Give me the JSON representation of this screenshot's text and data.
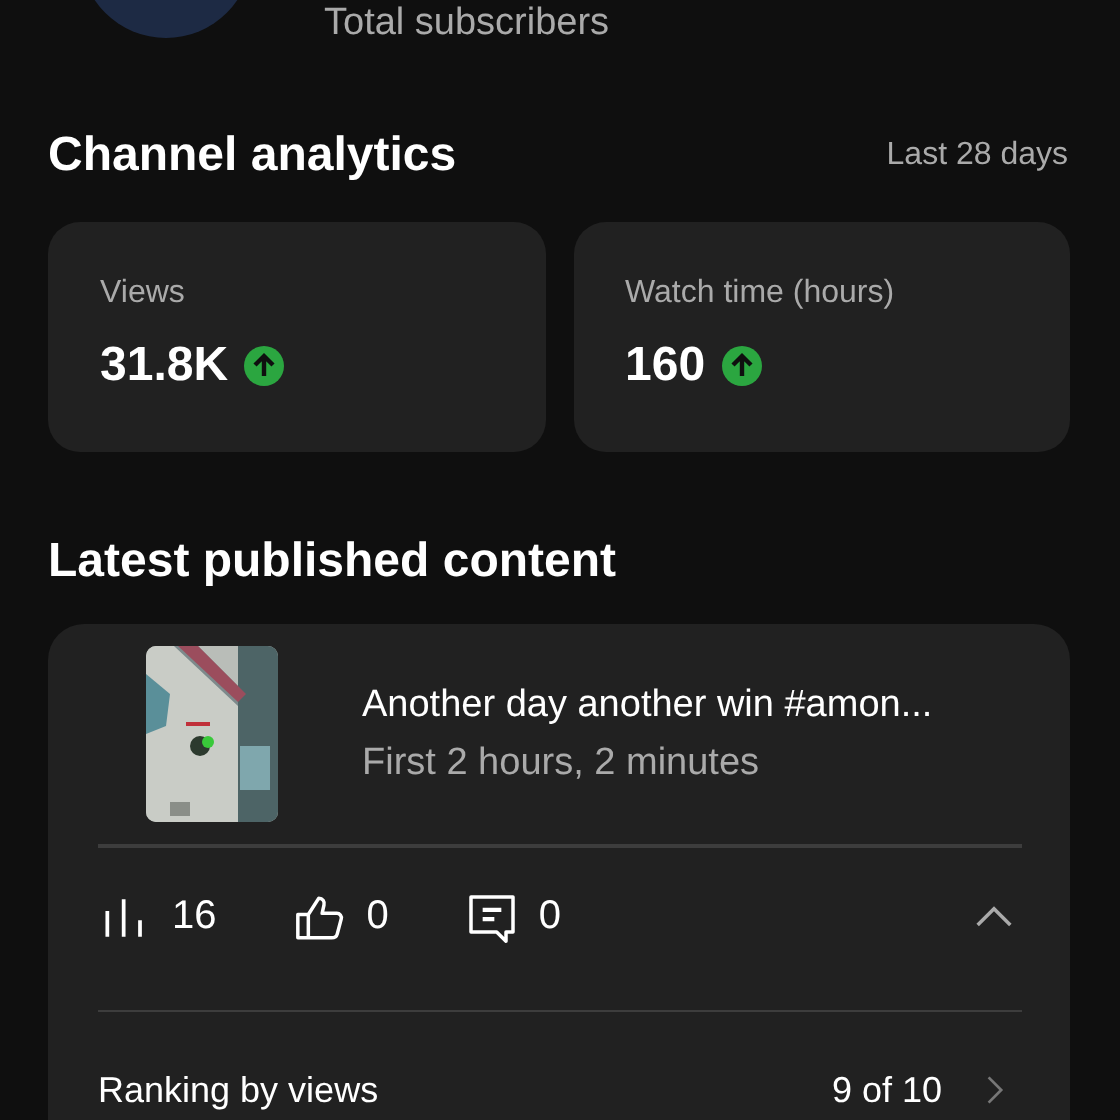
{
  "header": {
    "subtitle": "Total subscribers"
  },
  "analytics": {
    "title": "Channel analytics",
    "period": "Last 28 days",
    "cards": [
      {
        "label": "Views",
        "value": "31.8K",
        "rising": true
      },
      {
        "label": "Watch time (hours)",
        "value": "160",
        "rising": true
      }
    ]
  },
  "latest": {
    "title": "Latest published content",
    "item": {
      "title": "Another day another win #amon...",
      "subtitle": "First 2 hours, 2 minutes",
      "stats": [
        {
          "kind": "views",
          "value": "16"
        },
        {
          "kind": "likes",
          "value": "0"
        },
        {
          "kind": "comments",
          "value": "0"
        }
      ],
      "expanded": true,
      "ranking": {
        "label": "Ranking by views",
        "value": "9 of 10"
      }
    }
  }
}
